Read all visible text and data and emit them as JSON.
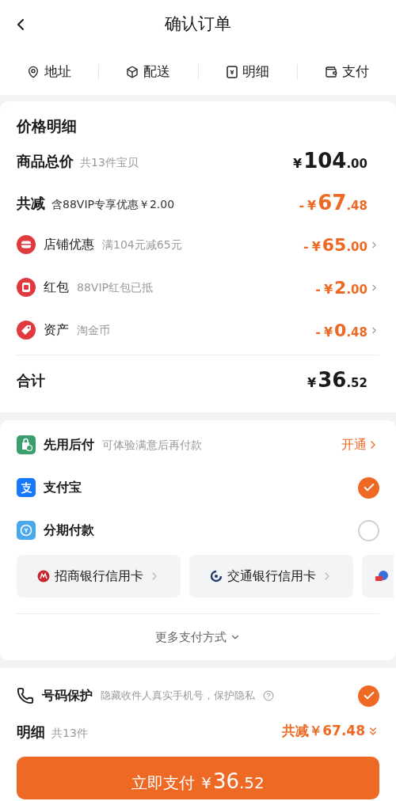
{
  "header": {
    "title": "确认订单"
  },
  "steps": [
    {
      "kind": "pin",
      "label": "地址"
    },
    {
      "kind": "box",
      "label": "配送"
    },
    {
      "kind": "receipt",
      "label": "明细"
    },
    {
      "kind": "wallet",
      "label": "支付"
    }
  ],
  "price_detail": {
    "title": "价格明细",
    "subtotal": {
      "label": "商品总价",
      "note": "共13件宝贝",
      "currency": "¥",
      "integer": "104",
      "decimal": ".00"
    },
    "reduction": {
      "label": "共减",
      "note": "含88VIP专享优惠￥2.00",
      "sign": "-",
      "currency": "¥",
      "integer": "67",
      "decimal": ".48"
    },
    "discounts": [
      {
        "kind": "store",
        "label": "店铺优惠",
        "note": "满104元减65元",
        "sign": "-",
        "currency": "¥",
        "integer": "65",
        "decimal": ".00"
      },
      {
        "kind": "redpacket",
        "label": "红包",
        "note": "88VIP红包已抵",
        "sign": "-",
        "currency": "¥",
        "integer": "2",
        "decimal": ".00"
      },
      {
        "kind": "asset",
        "label": "资产",
        "note": "淘金币",
        "sign": "-",
        "currency": "¥",
        "integer": "0",
        "decimal": ".48"
      }
    ],
    "total": {
      "label": "合计",
      "currency": "¥",
      "integer": "36",
      "decimal": ".52"
    }
  },
  "payment": {
    "methods": [
      {
        "kind": "paylater",
        "label": "先用后付",
        "note": "可体验满意后再付款",
        "action": "开通"
      },
      {
        "kind": "alipay",
        "label": "支付宝",
        "selected": true
      },
      {
        "kind": "installment",
        "label": "分期付款",
        "selected": false
      }
    ],
    "bank_cards": [
      {
        "kind": "cmb",
        "label": "招商银行信用卡"
      },
      {
        "kind": "bocom",
        "label": "交通银行信用卡"
      },
      {
        "kind": "other"
      }
    ],
    "more": "更多支付方式"
  },
  "privacy": {
    "label": "号码保护",
    "note": "隐藏收件人真实手机号，保护隐私",
    "checked": true
  },
  "summary": {
    "label": "明细",
    "count": "共13件",
    "savings": "共减￥67.48"
  },
  "pay_button": {
    "label": "立即支付",
    "currency": "¥",
    "integer": "36",
    "decimal": ".52"
  }
}
